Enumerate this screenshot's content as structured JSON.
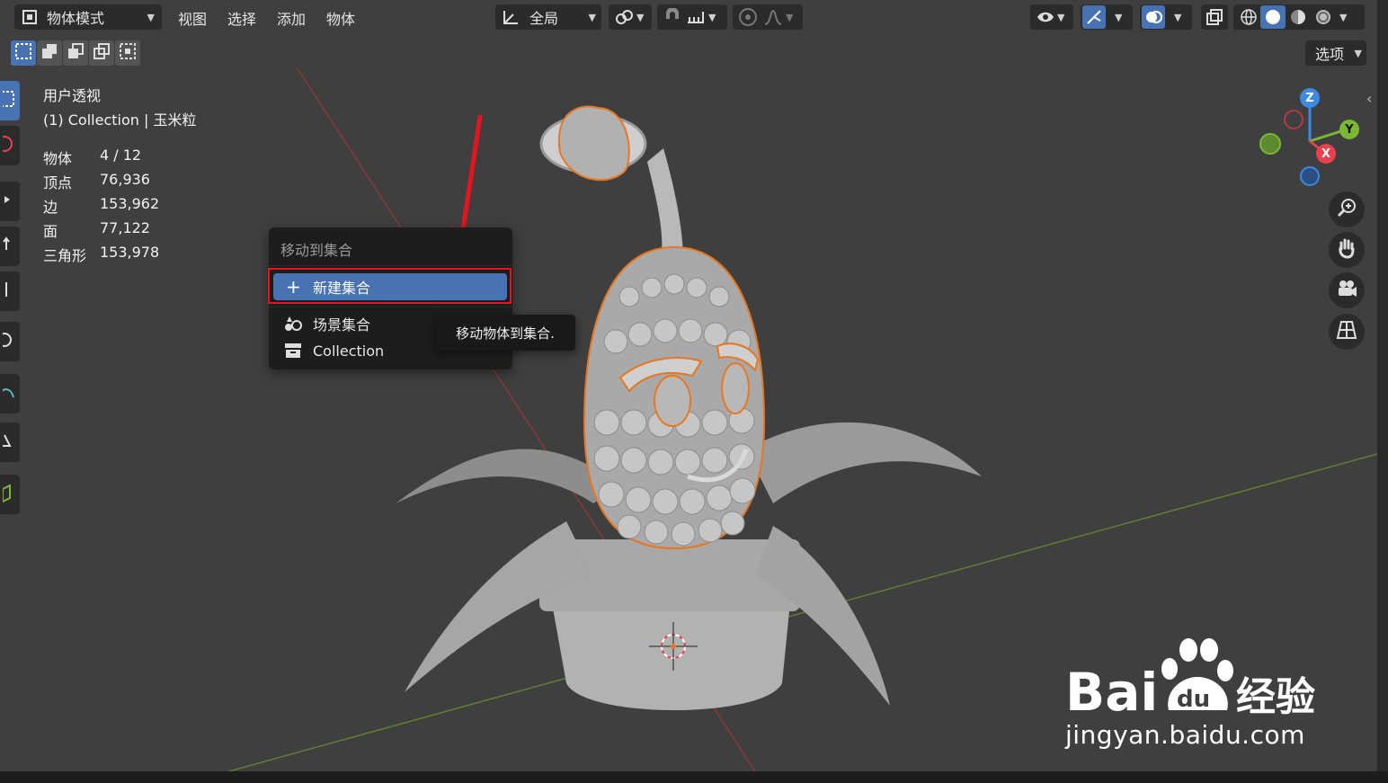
{
  "header": {
    "mode_label": "物体模式",
    "menus": [
      "视图",
      "选择",
      "添加",
      "物体"
    ],
    "transform_orientation": "全局",
    "options_label": "选项"
  },
  "overlay": {
    "view_name": "用户透视",
    "collection_info": "(1) Collection | 玉米粒",
    "stats": [
      {
        "label": "物体",
        "value": "4 / 12"
      },
      {
        "label": "顶点",
        "value": "76,936"
      },
      {
        "label": "边",
        "value": "153,962"
      },
      {
        "label": "面",
        "value": "77,122"
      },
      {
        "label": "三角形",
        "value": "153,978"
      }
    ]
  },
  "popup": {
    "title": "移动到集合",
    "new_collection": "新建集合",
    "items": [
      {
        "label": "场景集合",
        "icon": "scene-collection-icon"
      },
      {
        "label": "Collection",
        "icon": "collection-box-icon"
      }
    ],
    "tooltip": "移动物体到集合."
  },
  "gizmo": {
    "x": "X",
    "y": "Y",
    "z": "Z"
  },
  "watermark": {
    "text": "Bai du 经验",
    "url": "jingyan.baidu.com"
  },
  "colors": {
    "accent": "#4772b3",
    "highlight_box": "#e8141d",
    "arrow": "#e8141d",
    "selection_outline": "#e8771f",
    "axis_x": "#e8414d",
    "axis_y": "#7ab833",
    "axis_z": "#3d8ae3"
  }
}
